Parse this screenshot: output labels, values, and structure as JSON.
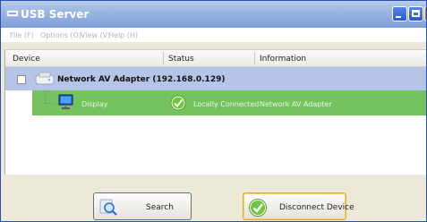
{
  "window": {
    "title": "USB Server"
  },
  "menu": [
    {
      "label": "File (F)"
    },
    {
      "label": "Options (O)"
    },
    {
      "label": "View (V)"
    },
    {
      "label": "Help (H)"
    }
  ],
  "table": {
    "columns": [
      "Device",
      "Status",
      "Information"
    ],
    "rows": [
      {
        "label": "Network AV Adapter  (192.168.0.129)"
      },
      {
        "device": "Display",
        "status": "Locally Connected",
        "information": "Network AV Adapter"
      }
    ]
  },
  "buttons": {
    "search": "Search",
    "disconnect": "Disconnect Device"
  },
  "colors": {
    "adapter_row": "#b6c4e8",
    "device_row": "#74c35e",
    "titlebar": "#7f9fd8"
  },
  "icons": [
    "usb-server-app-icon",
    "network-adapter-icon",
    "display-monitor-icon",
    "green-check-icon",
    "search-magnifier-icon"
  ]
}
